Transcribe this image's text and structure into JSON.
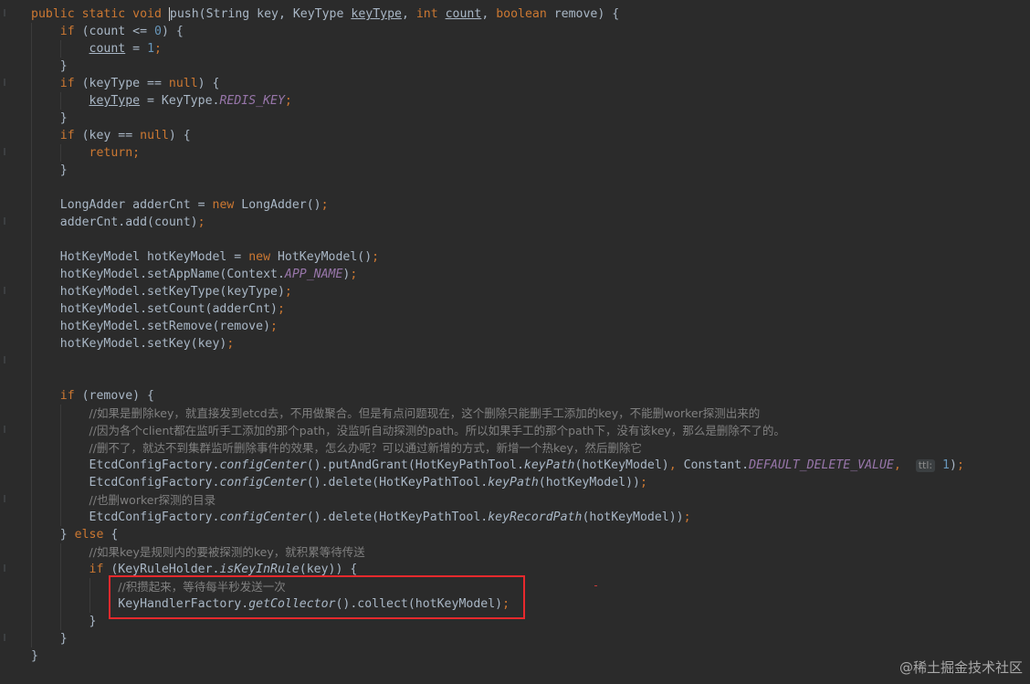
{
  "editor": {
    "code_lines": [
      [
        {
          "t": "public static void ",
          "c": "kw"
        },
        {
          "t": "p",
          "c": "caret"
        },
        {
          "t": "ush(String key, KeyType "
        },
        {
          "t": "keyType",
          "c": "ul"
        },
        {
          "t": ", "
        },
        {
          "t": "int ",
          "c": "kw"
        },
        {
          "t": "count",
          "c": "ul"
        },
        {
          "t": ", "
        },
        {
          "t": "boolean ",
          "c": "kw"
        },
        {
          "t": "remove) {"
        }
      ],
      [
        {
          "t": "    "
        },
        {
          "t": "if ",
          "c": "kw"
        },
        {
          "t": "(count <= "
        },
        {
          "t": "0",
          "c": "num"
        },
        {
          "t": ") {"
        }
      ],
      [
        {
          "t": "        "
        },
        {
          "t": "count",
          "c": "ul"
        },
        {
          "t": " = "
        },
        {
          "t": "1",
          "c": "num"
        },
        {
          "t": ";",
          "c": "kw"
        }
      ],
      [
        {
          "t": "    }"
        }
      ],
      [
        {
          "t": "    "
        },
        {
          "t": "if ",
          "c": "kw"
        },
        {
          "t": "(keyType == "
        },
        {
          "t": "null",
          "c": "kw"
        },
        {
          "t": ") {"
        }
      ],
      [
        {
          "t": "        "
        },
        {
          "t": "keyType",
          "c": "ul"
        },
        {
          "t": " = KeyType."
        },
        {
          "t": "REDIS_KEY",
          "c": "fld"
        },
        {
          "t": ";",
          "c": "kw"
        }
      ],
      [
        {
          "t": "    }"
        }
      ],
      [
        {
          "t": "    "
        },
        {
          "t": "if ",
          "c": "kw"
        },
        {
          "t": "(key == "
        },
        {
          "t": "null",
          "c": "kw"
        },
        {
          "t": ") {"
        }
      ],
      [
        {
          "t": "        "
        },
        {
          "t": "return;",
          "c": "kw"
        }
      ],
      [
        {
          "t": "    }"
        }
      ],
      [],
      [
        {
          "t": "    LongAdder adderCnt = "
        },
        {
          "t": "new ",
          "c": "kw"
        },
        {
          "t": "LongAdder()"
        },
        {
          "t": ";",
          "c": "kw"
        }
      ],
      [
        {
          "t": "    adderCnt.add(count)"
        },
        {
          "t": ";",
          "c": "kw"
        }
      ],
      [],
      [
        {
          "t": "    HotKeyModel hotKeyModel = "
        },
        {
          "t": "new ",
          "c": "kw"
        },
        {
          "t": "HotKeyModel()"
        },
        {
          "t": ";",
          "c": "kw"
        }
      ],
      [
        {
          "t": "    hotKeyModel.setAppName(Context."
        },
        {
          "t": "APP_NAME",
          "c": "fld"
        },
        {
          "t": ")"
        },
        {
          "t": ";",
          "c": "kw"
        }
      ],
      [
        {
          "t": "    hotKeyModel.setKeyType(keyType)"
        },
        {
          "t": ";",
          "c": "kw"
        }
      ],
      [
        {
          "t": "    hotKeyModel.setCount(adderCnt)"
        },
        {
          "t": ";",
          "c": "kw"
        }
      ],
      [
        {
          "t": "    hotKeyModel.setRemove(remove)"
        },
        {
          "t": ";",
          "c": "kw"
        }
      ],
      [
        {
          "t": "    hotKeyModel.setKey(key)"
        },
        {
          "t": ";",
          "c": "kw"
        }
      ],
      [],
      [],
      [
        {
          "t": "    "
        },
        {
          "t": "if ",
          "c": "kw"
        },
        {
          "t": "(remove) {"
        }
      ],
      [
        {
          "t": "        "
        },
        {
          "t": "//如果是删除key，就直接发到etcd去，不用做聚合。但是有点问题现在，这个删除只能删手工添加的key，不能删worker探测出来的",
          "c": "cmt"
        }
      ],
      [
        {
          "t": "        "
        },
        {
          "t": "//因为各个client都在监听手工添加的那个path，没监听自动探测的path。所以如果手工的那个path下，没有该key，那么是删除不了的。",
          "c": "cmt"
        }
      ],
      [
        {
          "t": "        "
        },
        {
          "t": "//删不了，就达不到集群监听删除事件的效果，怎么办呢？可以通过新增的方式，新增一个热key，然后删除它",
          "c": "cmt"
        }
      ],
      [
        {
          "t": "        EtcdConfigFactory."
        },
        {
          "t": "configCenter",
          "c": "stm"
        },
        {
          "t": "().putAndGrant(HotKeyPathTool."
        },
        {
          "t": "keyPath",
          "c": "stm"
        },
        {
          "t": "(hotKeyModel)"
        },
        {
          "t": ", ",
          "c": "kw"
        },
        {
          "t": "Constant."
        },
        {
          "t": "DEFAULT_DELETE_VALUE",
          "c": "fld"
        },
        {
          "t": ", ",
          "c": "kw"
        },
        {
          "t": " "
        },
        {
          "t": "ttl:",
          "c": "hint"
        },
        {
          "t": " "
        },
        {
          "t": "1",
          "c": "num"
        },
        {
          "t": ")"
        },
        {
          "t": ";",
          "c": "kw"
        }
      ],
      [
        {
          "t": "        EtcdConfigFactory."
        },
        {
          "t": "configCenter",
          "c": "stm"
        },
        {
          "t": "().delete(HotKeyPathTool."
        },
        {
          "t": "keyPath",
          "c": "stm"
        },
        {
          "t": "(hotKeyModel))"
        },
        {
          "t": ";",
          "c": "kw"
        }
      ],
      [
        {
          "t": "        "
        },
        {
          "t": "//也删worker探测的目录",
          "c": "cmt"
        }
      ],
      [
        {
          "t": "        EtcdConfigFactory."
        },
        {
          "t": "configCenter",
          "c": "stm"
        },
        {
          "t": "().delete(HotKeyPathTool."
        },
        {
          "t": "keyRecordPath",
          "c": "stm"
        },
        {
          "t": "(hotKeyModel))"
        },
        {
          "t": ";",
          "c": "kw"
        }
      ],
      [
        {
          "t": "    } "
        },
        {
          "t": "else ",
          "c": "kw"
        },
        {
          "t": "{"
        }
      ],
      [
        {
          "t": "        "
        },
        {
          "t": "//如果key是规则内的要被探测的key，就积累等待传送",
          "c": "cmt"
        }
      ],
      [
        {
          "t": "        "
        },
        {
          "t": "if ",
          "c": "kw"
        },
        {
          "t": "(KeyRuleHolder."
        },
        {
          "t": "isKeyInRule",
          "c": "stm"
        },
        {
          "t": "(key)) {"
        }
      ],
      [
        {
          "t": "            "
        },
        {
          "t": "//积攒起来，等待每半秒发送一次",
          "c": "cmt"
        }
      ],
      [
        {
          "t": "            KeyHandlerFactory."
        },
        {
          "t": "getCollector",
          "c": "stm"
        },
        {
          "t": "().collect(hotKeyModel)"
        },
        {
          "t": ";",
          "c": "kw"
        }
      ],
      [
        {
          "t": "        }"
        }
      ],
      [
        {
          "t": "    }"
        }
      ],
      [
        {
          "t": "}"
        }
      ]
    ]
  },
  "watermark": "@稀土掘金技术社区",
  "colors": {
    "background": "#2b2b2b",
    "text": "#a9b7c6",
    "keyword": "#cc7832",
    "number": "#6897bb",
    "comment": "#808080",
    "static_field": "#9876aa",
    "highlight_box": "#e8292d"
  }
}
